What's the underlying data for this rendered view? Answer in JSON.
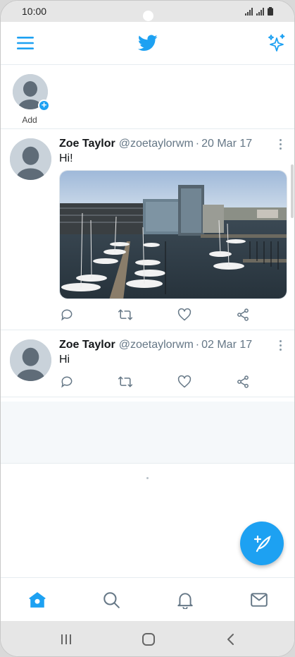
{
  "status_bar": {
    "time": "10:00"
  },
  "colors": {
    "accent": "#1da1f2",
    "icon_gray": "#657786",
    "text": "#14171a"
  },
  "header": {
    "menu_icon": "menu-icon",
    "logo_icon": "twitter-bird-icon",
    "sparkle_icon": "sparkle-icon"
  },
  "fleets": {
    "add_label": "Add"
  },
  "tweets": [
    {
      "name": "Zoe Taylor",
      "handle": "@zoetaylorwm",
      "sep": "·",
      "date": "20 Mar 17",
      "text": "Hi!",
      "has_media": true
    },
    {
      "name": "Zoe Taylor",
      "handle": "@zoetaylorwm",
      "sep": "·",
      "date": "02 Mar 17",
      "text": "Hi",
      "has_media": false
    }
  ],
  "tweet_actions": [
    "reply-icon",
    "retweet-icon",
    "like-icon",
    "share-icon"
  ],
  "tabs": [
    "home-icon",
    "search-icon",
    "notifications-icon",
    "messages-icon"
  ],
  "system_nav": [
    "recents-icon",
    "home-circle-icon",
    "back-icon"
  ]
}
